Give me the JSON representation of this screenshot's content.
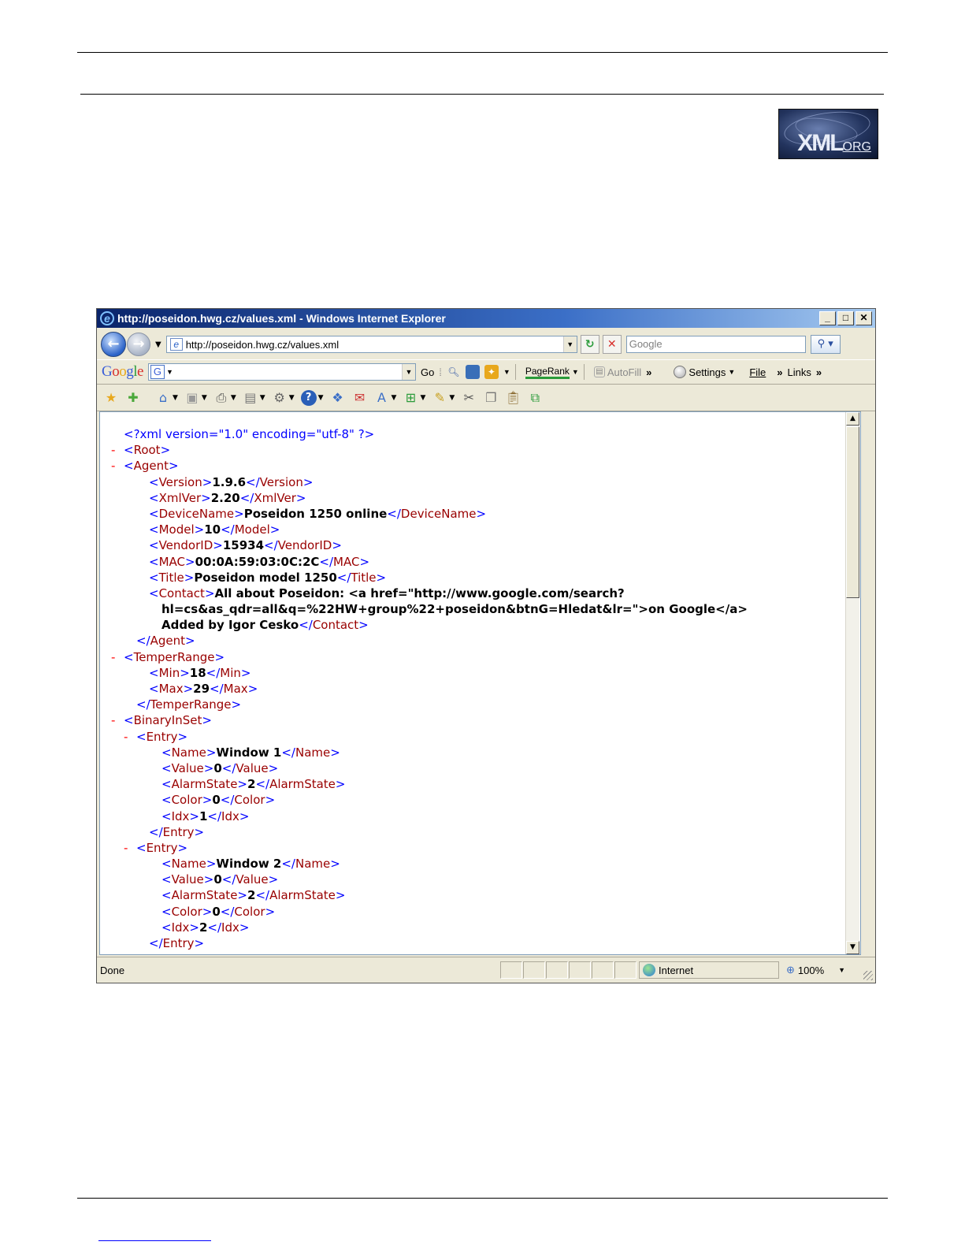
{
  "logo": {
    "text": "XML",
    "suffix": "ORG"
  },
  "window": {
    "title": "http://poseidon.hwg.cz/values.xml - Windows Internet Explorer",
    "minimize": "_",
    "maximize": "□",
    "close": "✕"
  },
  "address": {
    "url": "http://poseidon.hwg.cz/values.xml",
    "search_placeholder": "Google"
  },
  "google_toolbar": {
    "logo": [
      "G",
      "o",
      "o",
      "g",
      "l",
      "e"
    ],
    "go_label": "Go",
    "pagerank_label": "PageRank",
    "autofill_label": "AutoFill",
    "more": "»",
    "settings_label": "Settings",
    "file_label": "File",
    "links_label": "Links"
  },
  "xml_lines": [
    [
      {
        "c": "b",
        "t": "<?xml version=\"1.0\" encoding=\"utf-8\" ?>"
      }
    ],
    [
      {
        "c": "mi",
        "t": "-"
      },
      {
        "c": "b",
        "t": "<"
      },
      {
        "c": "t",
        "t": "Root"
      },
      {
        "c": "b",
        "t": ">"
      }
    ],
    [
      {
        "c": "mi",
        "t": "-"
      },
      {
        "c": "b",
        "t": "<"
      },
      {
        "c": "t",
        "t": "Agent"
      },
      {
        "c": "b",
        "t": ">"
      }
    ],
    [
      {
        "c": "b",
        "t": "<"
      },
      {
        "c": "t",
        "t": "Version"
      },
      {
        "c": "b",
        "t": ">"
      },
      {
        "c": "v",
        "t": "1.9.6"
      },
      {
        "c": "b",
        "t": "</"
      },
      {
        "c": "t",
        "t": "Version"
      },
      {
        "c": "b",
        "t": ">"
      }
    ],
    [
      {
        "c": "b",
        "t": "<"
      },
      {
        "c": "t",
        "t": "XmlVer"
      },
      {
        "c": "b",
        "t": ">"
      },
      {
        "c": "v",
        "t": "2.20"
      },
      {
        "c": "b",
        "t": "</"
      },
      {
        "c": "t",
        "t": "XmlVer"
      },
      {
        "c": "b",
        "t": ">"
      }
    ],
    [
      {
        "c": "b",
        "t": "<"
      },
      {
        "c": "t",
        "t": "DeviceName"
      },
      {
        "c": "b",
        "t": ">"
      },
      {
        "c": "v",
        "t": "Poseidon 1250 online"
      },
      {
        "c": "b",
        "t": "</"
      },
      {
        "c": "t",
        "t": "DeviceName"
      },
      {
        "c": "b",
        "t": ">"
      }
    ],
    [
      {
        "c": "b",
        "t": "<"
      },
      {
        "c": "t",
        "t": "Model"
      },
      {
        "c": "b",
        "t": ">"
      },
      {
        "c": "v",
        "t": "10"
      },
      {
        "c": "b",
        "t": "</"
      },
      {
        "c": "t",
        "t": "Model"
      },
      {
        "c": "b",
        "t": ">"
      }
    ],
    [
      {
        "c": "b",
        "t": "<"
      },
      {
        "c": "t",
        "t": "VendorID"
      },
      {
        "c": "b",
        "t": ">"
      },
      {
        "c": "v",
        "t": "15934"
      },
      {
        "c": "b",
        "t": "</"
      },
      {
        "c": "t",
        "t": "VendorID"
      },
      {
        "c": "b",
        "t": ">"
      }
    ],
    [
      {
        "c": "b",
        "t": "<"
      },
      {
        "c": "t",
        "t": "MAC"
      },
      {
        "c": "b",
        "t": ">"
      },
      {
        "c": "v",
        "t": "00:0A:59:03:0C:2C"
      },
      {
        "c": "b",
        "t": "</"
      },
      {
        "c": "t",
        "t": "MAC"
      },
      {
        "c": "b",
        "t": ">"
      }
    ],
    [
      {
        "c": "b",
        "t": "<"
      },
      {
        "c": "t",
        "t": "Title"
      },
      {
        "c": "b",
        "t": ">"
      },
      {
        "c": "v",
        "t": "Poseidon model 1250"
      },
      {
        "c": "b",
        "t": "</"
      },
      {
        "c": "t",
        "t": "Title"
      },
      {
        "c": "b",
        "t": ">"
      }
    ],
    [
      {
        "c": "b",
        "t": "<"
      },
      {
        "c": "t",
        "t": "Contact"
      },
      {
        "c": "b",
        "t": ">"
      },
      {
        "c": "v",
        "t": "All about Poseidon: <a href=\"http://www.google.com/search?"
      }
    ],
    [
      {
        "c": "v",
        "t": "hl=cs&as_qdr=all&q=%22HW+group%22+poseidon&btnG=Hledat&lr=\">on Google</a>"
      }
    ],
    [
      {
        "c": "v",
        "t": "Added by Igor Cesko"
      },
      {
        "c": "b",
        "t": "</"
      },
      {
        "c": "t",
        "t": "Contact"
      },
      {
        "c": "b",
        "t": ">"
      }
    ],
    [
      {
        "c": "b",
        "t": "</"
      },
      {
        "c": "t",
        "t": "Agent"
      },
      {
        "c": "b",
        "t": ">"
      }
    ],
    [
      {
        "c": "mi",
        "t": "-"
      },
      {
        "c": "b",
        "t": "<"
      },
      {
        "c": "t",
        "t": "TemperRange"
      },
      {
        "c": "b",
        "t": ">"
      }
    ],
    [
      {
        "c": "b",
        "t": "<"
      },
      {
        "c": "t",
        "t": "Min"
      },
      {
        "c": "b",
        "t": ">"
      },
      {
        "c": "v",
        "t": "18"
      },
      {
        "c": "b",
        "t": "</"
      },
      {
        "c": "t",
        "t": "Min"
      },
      {
        "c": "b",
        "t": ">"
      }
    ],
    [
      {
        "c": "b",
        "t": "<"
      },
      {
        "c": "t",
        "t": "Max"
      },
      {
        "c": "b",
        "t": ">"
      },
      {
        "c": "v",
        "t": "29"
      },
      {
        "c": "b",
        "t": "</"
      },
      {
        "c": "t",
        "t": "Max"
      },
      {
        "c": "b",
        "t": ">"
      }
    ],
    [
      {
        "c": "b",
        "t": "</"
      },
      {
        "c": "t",
        "t": "TemperRange"
      },
      {
        "c": "b",
        "t": ">"
      }
    ],
    [
      {
        "c": "mi",
        "t": "-"
      },
      {
        "c": "b",
        "t": "<"
      },
      {
        "c": "t",
        "t": "BinaryInSet"
      },
      {
        "c": "b",
        "t": ">"
      }
    ],
    [
      {
        "c": "mi",
        "t": "-"
      },
      {
        "c": "b",
        "t": "<"
      },
      {
        "c": "t",
        "t": "Entry"
      },
      {
        "c": "b",
        "t": ">"
      }
    ],
    [
      {
        "c": "b",
        "t": "<"
      },
      {
        "c": "t",
        "t": "Name"
      },
      {
        "c": "b",
        "t": ">"
      },
      {
        "c": "v",
        "t": "Window 1"
      },
      {
        "c": "b",
        "t": "</"
      },
      {
        "c": "t",
        "t": "Name"
      },
      {
        "c": "b",
        "t": ">"
      }
    ],
    [
      {
        "c": "b",
        "t": "<"
      },
      {
        "c": "t",
        "t": "Value"
      },
      {
        "c": "b",
        "t": ">"
      },
      {
        "c": "v",
        "t": "0"
      },
      {
        "c": "b",
        "t": "</"
      },
      {
        "c": "t",
        "t": "Value"
      },
      {
        "c": "b",
        "t": ">"
      }
    ],
    [
      {
        "c": "b",
        "t": "<"
      },
      {
        "c": "t",
        "t": "AlarmState"
      },
      {
        "c": "b",
        "t": ">"
      },
      {
        "c": "v",
        "t": "2"
      },
      {
        "c": "b",
        "t": "</"
      },
      {
        "c": "t",
        "t": "AlarmState"
      },
      {
        "c": "b",
        "t": ">"
      }
    ],
    [
      {
        "c": "b",
        "t": "<"
      },
      {
        "c": "t",
        "t": "Color"
      },
      {
        "c": "b",
        "t": ">"
      },
      {
        "c": "v",
        "t": "0"
      },
      {
        "c": "b",
        "t": "</"
      },
      {
        "c": "t",
        "t": "Color"
      },
      {
        "c": "b",
        "t": ">"
      }
    ],
    [
      {
        "c": "b",
        "t": "<"
      },
      {
        "c": "t",
        "t": "Idx"
      },
      {
        "c": "b",
        "t": ">"
      },
      {
        "c": "v",
        "t": "1"
      },
      {
        "c": "b",
        "t": "</"
      },
      {
        "c": "t",
        "t": "Idx"
      },
      {
        "c": "b",
        "t": ">"
      }
    ],
    [
      {
        "c": "b",
        "t": "</"
      },
      {
        "c": "t",
        "t": "Entry"
      },
      {
        "c": "b",
        "t": ">"
      }
    ],
    [
      {
        "c": "mi",
        "t": "-"
      },
      {
        "c": "b",
        "t": "<"
      },
      {
        "c": "t",
        "t": "Entry"
      },
      {
        "c": "b",
        "t": ">"
      }
    ],
    [
      {
        "c": "b",
        "t": "<"
      },
      {
        "c": "t",
        "t": "Name"
      },
      {
        "c": "b",
        "t": ">"
      },
      {
        "c": "v",
        "t": "Window 2"
      },
      {
        "c": "b",
        "t": "</"
      },
      {
        "c": "t",
        "t": "Name"
      },
      {
        "c": "b",
        "t": ">"
      }
    ],
    [
      {
        "c": "b",
        "t": "<"
      },
      {
        "c": "t",
        "t": "Value"
      },
      {
        "c": "b",
        "t": ">"
      },
      {
        "c": "v",
        "t": "0"
      },
      {
        "c": "b",
        "t": "</"
      },
      {
        "c": "t",
        "t": "Value"
      },
      {
        "c": "b",
        "t": ">"
      }
    ],
    [
      {
        "c": "b",
        "t": "<"
      },
      {
        "c": "t",
        "t": "AlarmState"
      },
      {
        "c": "b",
        "t": ">"
      },
      {
        "c": "v",
        "t": "2"
      },
      {
        "c": "b",
        "t": "</"
      },
      {
        "c": "t",
        "t": "AlarmState"
      },
      {
        "c": "b",
        "t": ">"
      }
    ],
    [
      {
        "c": "b",
        "t": "<"
      },
      {
        "c": "t",
        "t": "Color"
      },
      {
        "c": "b",
        "t": ">"
      },
      {
        "c": "v",
        "t": "0"
      },
      {
        "c": "b",
        "t": "</"
      },
      {
        "c": "t",
        "t": "Color"
      },
      {
        "c": "b",
        "t": ">"
      }
    ],
    [
      {
        "c": "b",
        "t": "<"
      },
      {
        "c": "t",
        "t": "Idx"
      },
      {
        "c": "b",
        "t": ">"
      },
      {
        "c": "v",
        "t": "2"
      },
      {
        "c": "b",
        "t": "</"
      },
      {
        "c": "t",
        "t": "Idx"
      },
      {
        "c": "b",
        "t": ">"
      }
    ],
    [
      {
        "c": "b",
        "t": "</"
      },
      {
        "c": "t",
        "t": "Entry"
      },
      {
        "c": "b",
        "t": ">"
      }
    ]
  ],
  "status": {
    "text": "Done",
    "zone": "Internet",
    "zoom": "100%"
  },
  "colors": {
    "tag": "#990000",
    "bracket": "#0000ff",
    "collapse": "#ff0000"
  }
}
